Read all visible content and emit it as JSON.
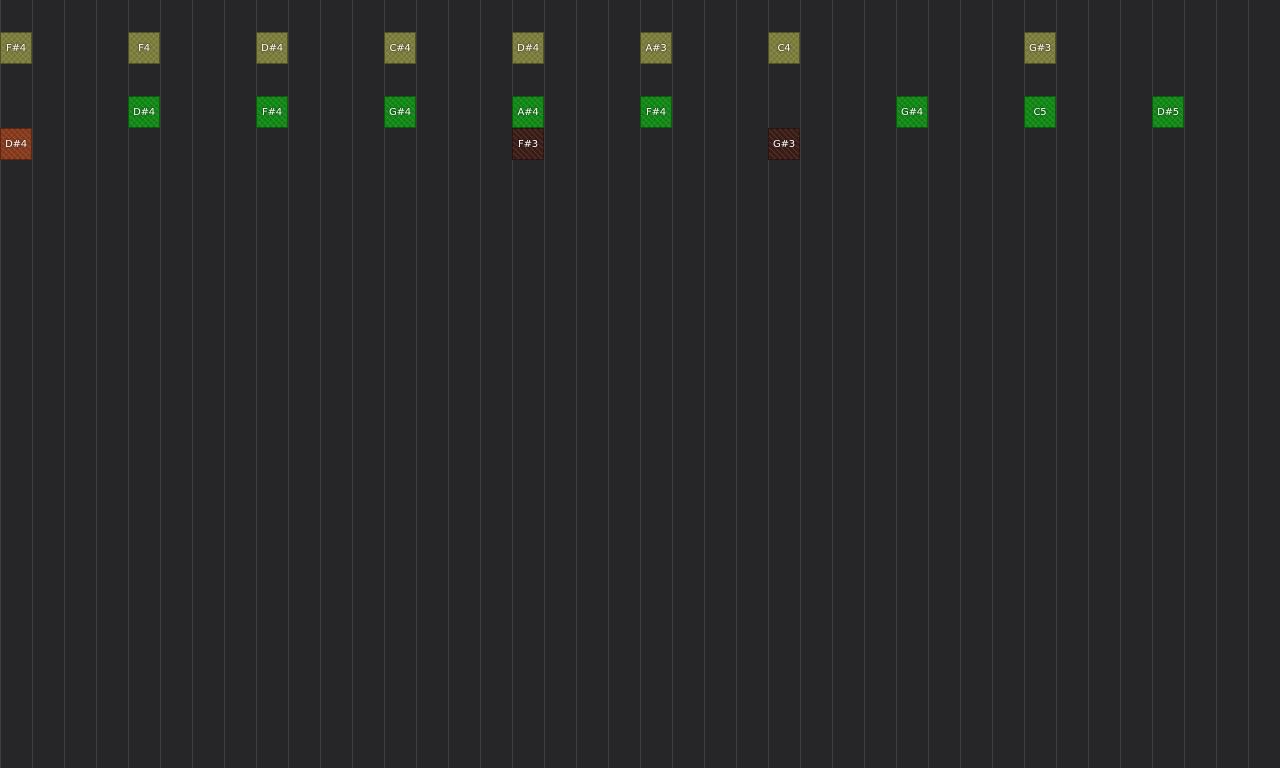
{
  "colors": {
    "background": "#262628",
    "gridline": "#3e3e40",
    "olive": "#7d7f3c",
    "green": "#118a15",
    "orange": "#8a3a1c",
    "darkred": "#3c1c16",
    "label": "#ffffff"
  },
  "rows": [
    {
      "name": "row-1",
      "color": "olive",
      "notes": [
        {
          "col": 0,
          "label": "F#4"
        },
        {
          "col": 4,
          "label": "F4"
        },
        {
          "col": 8,
          "label": "D#4"
        },
        {
          "col": 12,
          "label": "C#4"
        },
        {
          "col": 16,
          "label": "D#4"
        },
        {
          "col": 20,
          "label": "A#3"
        },
        {
          "col": 24,
          "label": "C4"
        },
        {
          "col": 32,
          "label": "G#3"
        }
      ]
    },
    {
      "name": "row-3",
      "color": "green",
      "notes": [
        {
          "col": 4,
          "label": "D#4"
        },
        {
          "col": 8,
          "label": "F#4"
        },
        {
          "col": 12,
          "label": "G#4"
        },
        {
          "col": 16,
          "label": "A#4"
        },
        {
          "col": 20,
          "label": "F#4"
        },
        {
          "col": 28,
          "label": "G#4"
        },
        {
          "col": 32,
          "label": "C5"
        },
        {
          "col": 36,
          "label": "D#5"
        }
      ]
    },
    {
      "name": "row-4",
      "color": "mixed",
      "notes": [
        {
          "col": 0,
          "label": "D#4",
          "color": "orange"
        },
        {
          "col": 16,
          "label": "F#3",
          "color": "darkred"
        },
        {
          "col": 24,
          "label": "G#3",
          "color": "darkred"
        }
      ]
    }
  ]
}
